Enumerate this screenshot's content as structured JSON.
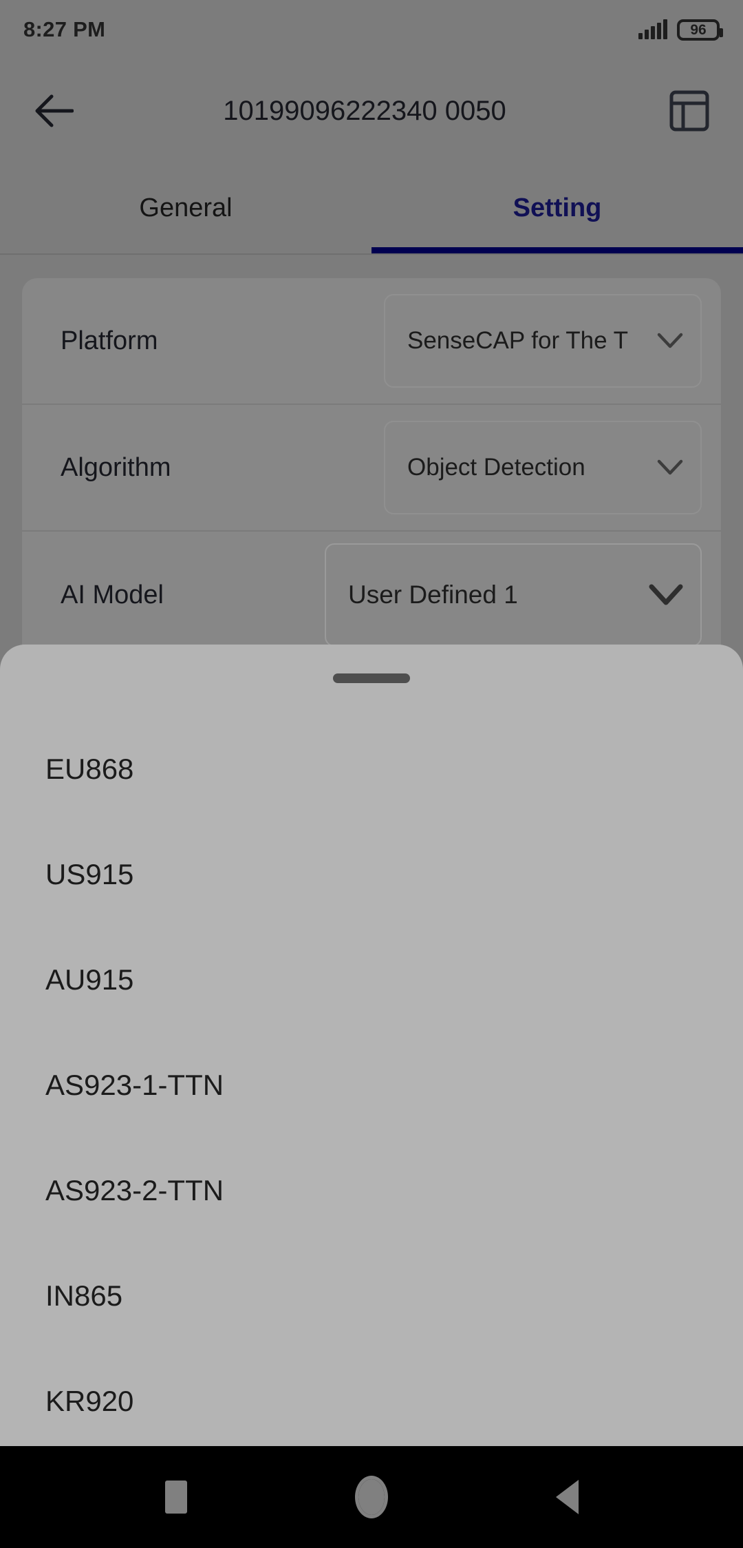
{
  "status_bar": {
    "time": "8:27 PM",
    "battery_percent": "96",
    "signal_icon": "signal-bars-icon",
    "battery_icon": "battery-icon"
  },
  "app_bar": {
    "back_icon": "back-arrow-icon",
    "title": "10199096222340 0050",
    "layout_icon": "layout-panel-icon"
  },
  "tabs": [
    {
      "label": "General",
      "active": false
    },
    {
      "label": "Setting",
      "active": true
    }
  ],
  "settings": [
    {
      "label": "Platform",
      "value": "SenseCAP for The T",
      "chevron": "chevron-down-icon"
    },
    {
      "label": "Algorithm",
      "value": "Object Detection",
      "chevron": "chevron-down-icon"
    },
    {
      "label": "AI Model",
      "value": "User Defined 1",
      "chevron": "chevron-down-icon"
    }
  ],
  "bottom_sheet": {
    "handle_icon": "drag-handle-icon",
    "options": [
      {
        "label": "EU868"
      },
      {
        "label": "US915"
      },
      {
        "label": "AU915"
      },
      {
        "label": "AS923-1-TTN"
      },
      {
        "label": "AS923-2-TTN"
      },
      {
        "label": "IN865"
      },
      {
        "label": "KR920"
      }
    ]
  },
  "nav_bar": {
    "recents_icon": "square-recents-icon",
    "home_icon": "circle-home-icon",
    "back_icon": "triangle-back-icon"
  },
  "colors": {
    "scrim": "#7c7c7c",
    "card": "#878787",
    "sheet": "#b4b4b4",
    "accent": "#000050",
    "nav_bar": "#000000"
  }
}
